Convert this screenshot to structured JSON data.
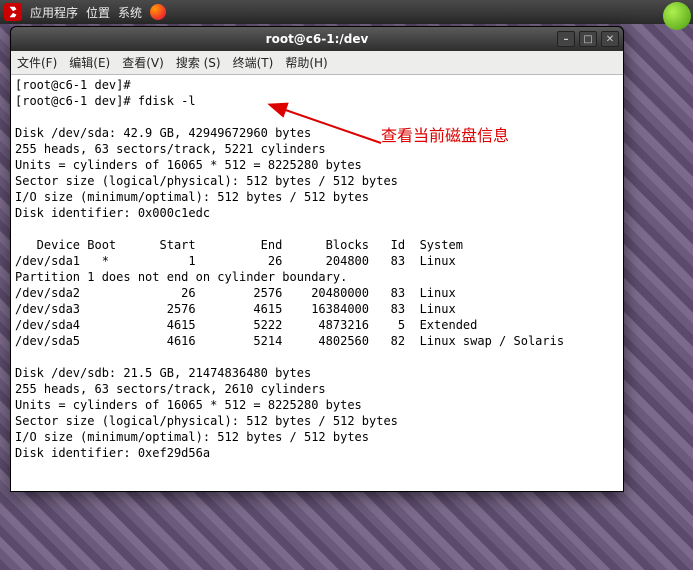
{
  "taskbar": {
    "items": [
      "应用程序",
      "位置",
      "系统"
    ]
  },
  "window": {
    "title": "root@c6-1:/dev",
    "controls": {
      "min": "–",
      "max": "□",
      "close": "✕"
    }
  },
  "menubar": {
    "items": [
      "文件(F)",
      "编辑(E)",
      "查看(V)",
      "搜索 (S)",
      "终端(T)",
      "帮助(H)"
    ]
  },
  "terminal": {
    "prompts": [
      "[root@c6-1 dev]#",
      "[root@c6-1 dev]# fdisk -l"
    ],
    "disks": [
      {
        "header": "Disk /dev/sda: 42.9 GB, 42949672960 bytes",
        "geom": "255 heads, 63 sectors/track, 5221 cylinders",
        "units": "Units = cylinders of 16065 * 512 = 8225280 bytes",
        "sector": "Sector size (logical/physical): 512 bytes / 512 bytes",
        "io": "I/O size (minimum/optimal): 512 bytes / 512 bytes",
        "id": "Disk identifier: 0x000c1edc",
        "part_header": "   Device Boot      Start         End      Blocks   Id  System",
        "partitions": [
          {
            "line": "/dev/sda1   *           1          26      204800   83  Linux"
          },
          {
            "note": "Partition 1 does not end on cylinder boundary."
          },
          {
            "line": "/dev/sda2              26        2576    20480000   83  Linux"
          },
          {
            "line": "/dev/sda3            2576        4615    16384000   83  Linux"
          },
          {
            "line": "/dev/sda4            4615        5222     4873216    5  Extended"
          },
          {
            "line": "/dev/sda5            4616        5214     4802560   82  Linux swap / Solaris"
          }
        ]
      },
      {
        "header": "Disk /dev/sdb: 21.5 GB, 21474836480 bytes",
        "geom": "255 heads, 63 sectors/track, 2610 cylinders",
        "units": "Units = cylinders of 16065 * 512 = 8225280 bytes",
        "sector": "Sector size (logical/physical): 512 bytes / 512 bytes",
        "io": "I/O size (minimum/optimal): 512 bytes / 512 bytes",
        "id": "Disk identifier: 0xef29d56a"
      }
    ]
  },
  "annotation": {
    "label": "查看当前磁盘信息"
  }
}
